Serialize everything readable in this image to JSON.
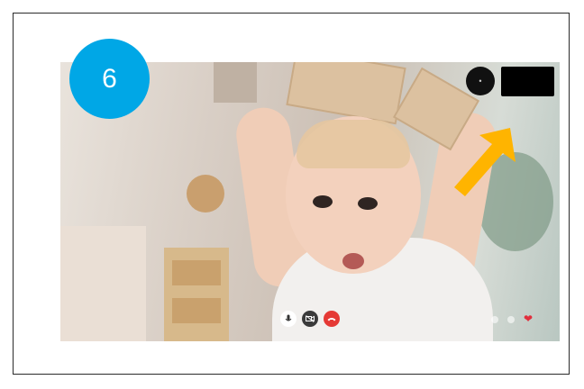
{
  "step": {
    "number": "6"
  },
  "video": {
    "controls": {
      "mic_icon": "microphone-icon",
      "camera_icon": "camera-off-icon",
      "end_icon": "end-call-icon"
    },
    "reaction_icon": "heart-icon"
  },
  "colors": {
    "badge": "#00a7e6",
    "arrow": "#ffb400",
    "end_call": "#e53935",
    "heart": "#e12f3d"
  }
}
